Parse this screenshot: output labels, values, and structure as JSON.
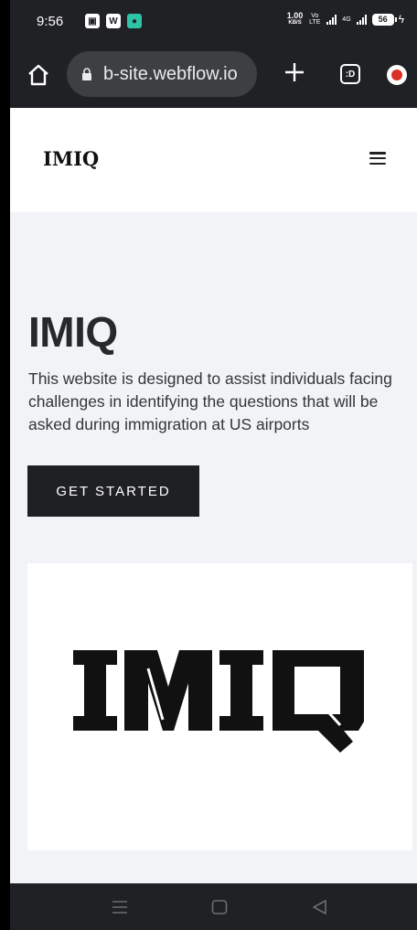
{
  "status_bar": {
    "time": "9:56",
    "net_speed_value": "1.00",
    "net_speed_unit": "KB/S",
    "volte": "Vo LTE",
    "network": "4G",
    "battery": "56"
  },
  "browser": {
    "url": "b-site.webflow.io",
    "tabs_label": ":D"
  },
  "site": {
    "nav_logo": "IMIQ",
    "hero_title": "IMIQ",
    "hero_description": "This website is designed to assist individuals facing challenges in identifying the questions that will be asked during immigration at US airports",
    "cta_label": "GET STARTED",
    "logo_image_text": "IMIQ"
  },
  "colors": {
    "browser_bg": "#202124",
    "page_bg": "#f1f3f6",
    "button_bg": "#1f2024",
    "text_dark": "#27282c"
  },
  "icons": {
    "home": "home-icon",
    "lock": "lock-icon",
    "new_tab": "plus-icon",
    "menu": "hamburger-menu-icon",
    "android_recents": "recents-icon",
    "android_home": "home-square-icon",
    "android_back": "back-triangle-icon"
  }
}
